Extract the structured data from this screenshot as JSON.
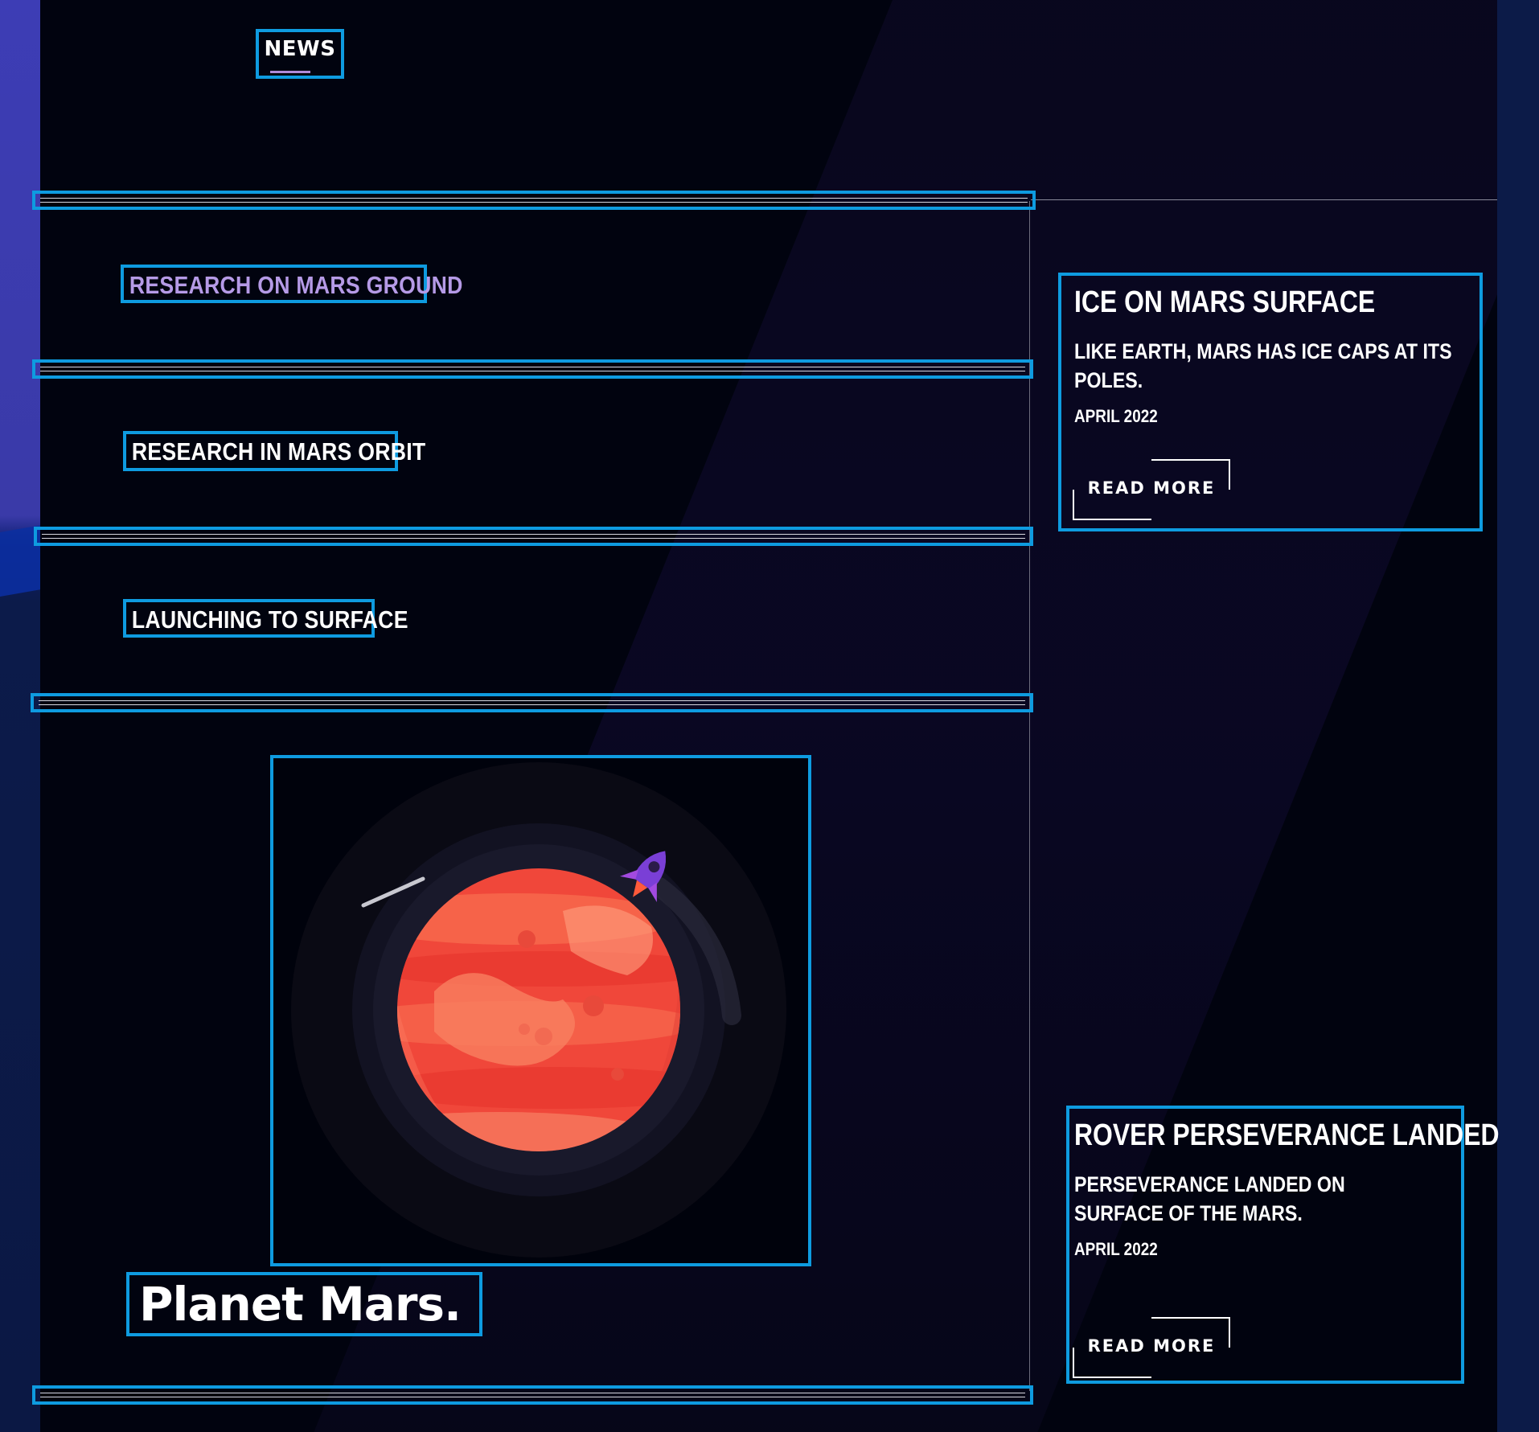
{
  "nav": {
    "news_label": "NEWS"
  },
  "topics": [
    {
      "label": "RESEARCH ON MARS GROUND",
      "active": true
    },
    {
      "label": "RESEARCH IN MARS ORBIT",
      "active": false
    },
    {
      "label": "LAUNCHING TO SURFACE",
      "active": false
    }
  ],
  "hero": {
    "title": "Planet Mars."
  },
  "cards": [
    {
      "title": "ICE ON MARS SURFACE",
      "text": "LIKE EARTH, MARS HAS ICE CAPS AT ITS POLES.",
      "date": "APRIL 2022",
      "button": "READ MORE"
    },
    {
      "title": "ROVER PERSEVERANCE LANDED",
      "text": "PERSEVERANCE LANDED ON SURFACE OF THE MARS.",
      "date": "APRIL 2022",
      "button": "READ MORE"
    }
  ],
  "colors": {
    "accent_blue": "#0e9be0",
    "active_topic": "#b59ae6",
    "background": "#01030f",
    "planet_red": "#f0473a"
  },
  "icons": {
    "planet": "mars-planet-illustration",
    "rocket": "rocket-icon"
  }
}
